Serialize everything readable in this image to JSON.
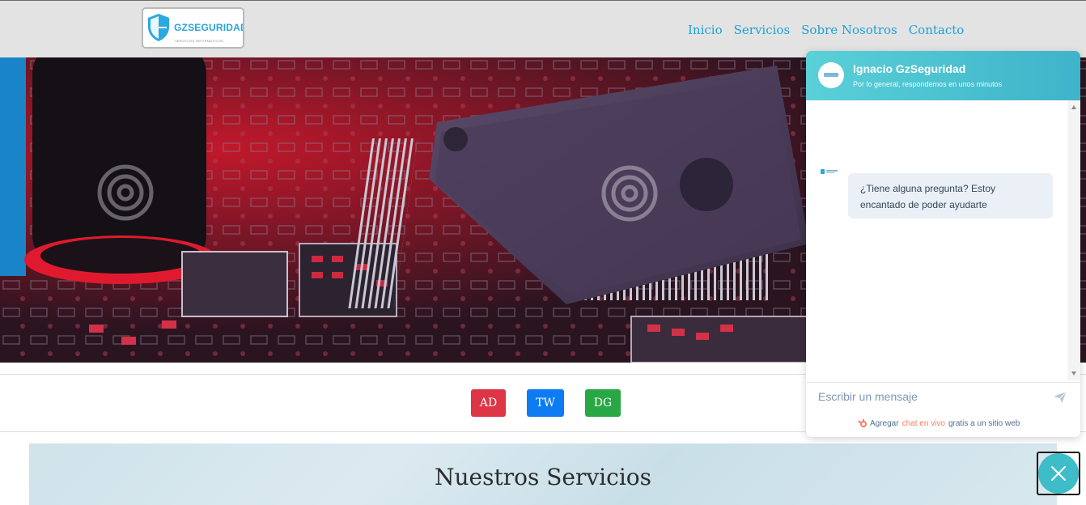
{
  "header": {
    "logo": {
      "name": "GZSEGURIDAD",
      "subtitle": "SERVICIOS INFORMÁTICOS"
    },
    "nav": [
      "Inicio",
      "Servicios",
      "Sobre Nosotros",
      "Contacto"
    ]
  },
  "badges": [
    "AD",
    "TW",
    "DG"
  ],
  "badge_colors": [
    "#dc3545",
    "#0d7bf2",
    "#28a745"
  ],
  "services": {
    "title": "Nuestros Servicios"
  },
  "chat": {
    "agent_name": "Ignacio GzSeguridad",
    "response_time": "Por lo general, respondemos en unos minutos",
    "message": "¿Tiene alguna pregunta? Estoy encantado de poder ayudarte",
    "input_placeholder": "Escribir un mensaje",
    "powered_prefix": "Agregar",
    "powered_link": "chat en vivo",
    "powered_suffix": "gratis a un sitio web",
    "header_color": "#4cc4d2",
    "accent": "#ff7a59"
  },
  "icons": [
    "shield-icon",
    "send-icon",
    "hubspot-icon",
    "close-icon",
    "scroll-up-icon",
    "scroll-down-icon"
  ]
}
